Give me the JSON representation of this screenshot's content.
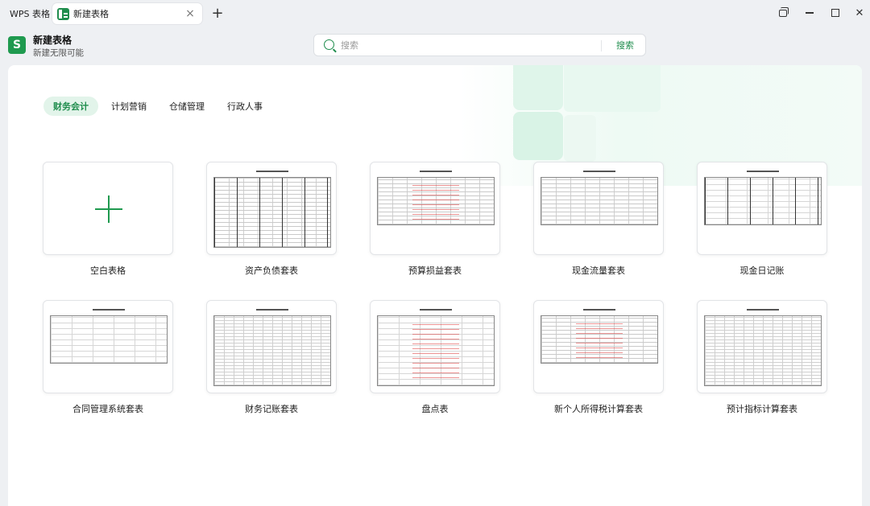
{
  "tabs": {
    "wps_label": "WPS 表格",
    "new_label": "新建表格",
    "close_glyph": "×",
    "add_glyph": "+"
  },
  "header": {
    "logo_letter": "S",
    "title": "新建表格",
    "subtitle": "新建无限可能"
  },
  "search": {
    "placeholder": "搜索",
    "button_label": "搜索"
  },
  "categories": [
    {
      "label": "财务会计",
      "active": true
    },
    {
      "label": "计划营销",
      "active": false
    },
    {
      "label": "仓储管理",
      "active": false
    },
    {
      "label": "行政人事",
      "active": false
    }
  ],
  "templates": [
    {
      "label": "空白表格"
    },
    {
      "label": "资产负债套表"
    },
    {
      "label": "预算损益套表"
    },
    {
      "label": "现金流量套表"
    },
    {
      "label": "现金日记账"
    },
    {
      "label": "合同管理系统套表"
    },
    {
      "label": "财务记账套表"
    },
    {
      "label": "盘点表"
    },
    {
      "label": "新个人所得税计算套表"
    },
    {
      "label": "预计指标计算套表"
    }
  ],
  "colors": {
    "accent": "#1f8d4d",
    "accent_light": "#e2f4ea",
    "background": "#eef0f3"
  }
}
